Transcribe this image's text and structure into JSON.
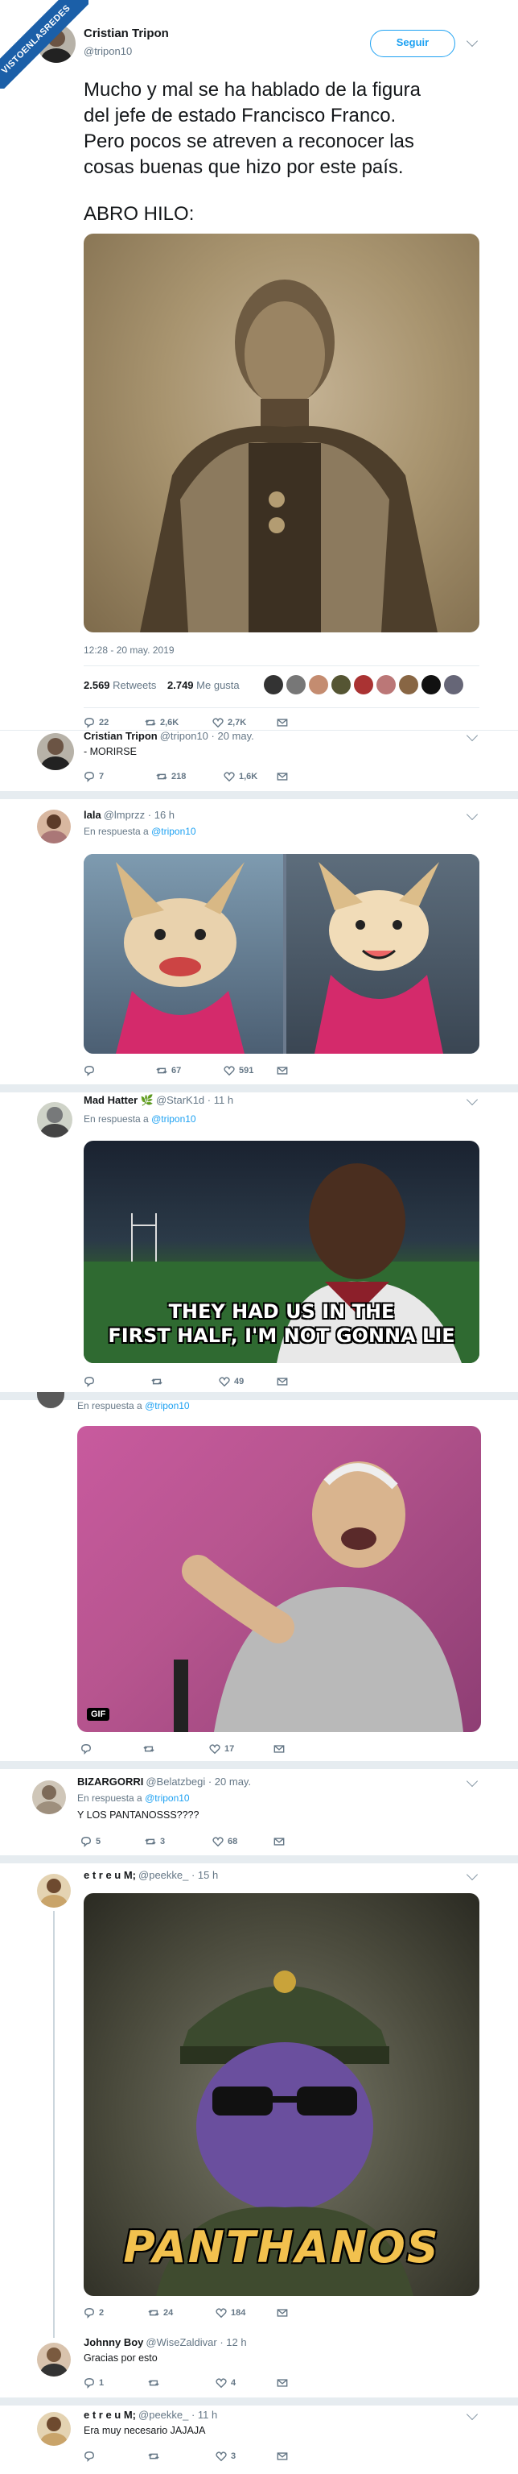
{
  "watermark": "VISTOENLASREDES",
  "colors": {
    "accent": "#1da1f2",
    "text": "#14171a",
    "muted": "#657786",
    "border": "#e6ecf0"
  },
  "main_tweet": {
    "name": "Cristian Tripon",
    "handle": "@tripon10",
    "follow_label": "Seguir",
    "lines": [
      "Mucho y mal se ha hablado de la figura",
      "del jefe de estado Francisco Franco.",
      "Pero pocos se atreven a reconocer las",
      "cosas buenas que hizo por este país."
    ],
    "line_thread": "ABRO HILO:",
    "timestamp": "12:28 - 20 may. 2019",
    "retweets_count": "2.569",
    "retweets_label": "Retweets",
    "likes_count": "2.749",
    "likes_label": "Me gusta",
    "action_counts": {
      "reply": "22",
      "retweet": "2,6K",
      "like": "2,7K"
    }
  },
  "replies": [
    {
      "name": "Cristian Tripon",
      "handle": "@tripon10 · 20 may.",
      "text": "- MORIRSE",
      "counts": {
        "reply": "7",
        "retweet": "218",
        "like": "1,6K"
      }
    },
    {
      "name": "lala",
      "handle": "@lmprzz · 16 h",
      "reply_to_prefix": "En respuesta a",
      "reply_to": "@tripon10",
      "counts": {
        "reply": "",
        "retweet": "67",
        "like": "591"
      }
    },
    {
      "name": "Mad Hatter 🌿",
      "handle": "@StarK1d · 11 h",
      "reply_to_prefix": "En respuesta a",
      "reply_to": "@tripon10",
      "meme_line1": "THEY HAD US IN THE",
      "meme_line2": "FIRST HALF, I'M NOT GONNA LIE",
      "counts": {
        "reply": "",
        "retweet": "",
        "like": "49"
      }
    },
    {
      "reply_to_prefix": "En respuesta a",
      "reply_to": "@tripon10",
      "gif_label": "GIF",
      "counts": {
        "reply": "",
        "retweet": "",
        "like": "17"
      }
    },
    {
      "name": "BIZARGORRI",
      "handle": "@Belatzbegi · 20 may.",
      "reply_to_prefix": "En respuesta a",
      "reply_to": "@tripon10",
      "text": "Y LOS PANTANOSSS????",
      "counts": {
        "reply": "5",
        "retweet": "3",
        "like": "68"
      }
    },
    {
      "name": "e t r e u M;",
      "handle": "@peekke_ · 15 h",
      "meme_text": "PANTHANOS",
      "counts": {
        "reply": "2",
        "retweet": "24",
        "like": "184"
      }
    },
    {
      "name": "Johnny Boy",
      "handle": "@WiseZaldivar · 12 h",
      "text": "Gracias por esto",
      "counts": {
        "reply": "1",
        "retweet": "",
        "like": "4"
      }
    },
    {
      "name": "e t r e u M;",
      "handle": "@peekke_ · 11 h",
      "text": "Era muy necesario JAJAJA",
      "counts": {
        "reply": "",
        "retweet": "",
        "like": "3"
      }
    }
  ]
}
